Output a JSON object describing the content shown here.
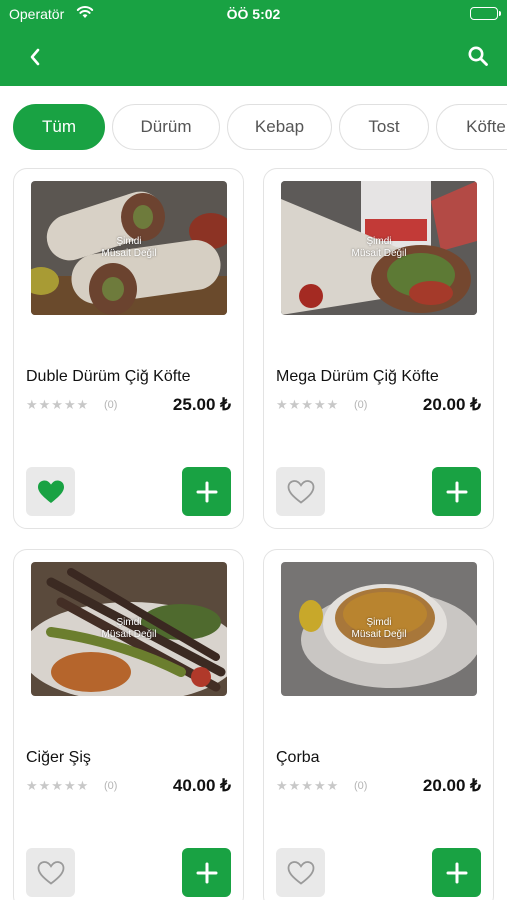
{
  "status_bar": {
    "carrier": "Operatör",
    "time": "ÖÖ 5:02"
  },
  "header": {
    "back_icon": "chevron-left-icon",
    "search_icon": "search-icon"
  },
  "categories": [
    {
      "label": "Tüm",
      "active": true
    },
    {
      "label": "Dürüm",
      "active": false
    },
    {
      "label": "Kebap",
      "active": false
    },
    {
      "label": "Tost",
      "active": false
    },
    {
      "label": "Köfte",
      "active": false
    }
  ],
  "products": [
    {
      "name": "Duble Dürüm Çiğ Köfte",
      "price": "25.00 ₺",
      "rating_count": "(0)",
      "stars": "★★★★★",
      "favorited": true,
      "availability_line1": "Şimdi",
      "availability_line2": "Müsait Değil",
      "image": "wrap-icon"
    },
    {
      "name": "Mega Dürüm Çiğ Köfte",
      "price": "20.00 ₺",
      "rating_count": "(0)",
      "stars": "★★★★★",
      "favorited": false,
      "availability_line1": "Şimdi",
      "availability_line2": "Müsait Değil",
      "image": "wrap-icon"
    },
    {
      "name": "Ciğer Şiş",
      "price": "40.00 ₺",
      "rating_count": "(0)",
      "stars": "★★★★★",
      "favorited": false,
      "availability_line1": "Şimdi",
      "availability_line2": "Müsait Değil",
      "image": "skewer-icon"
    },
    {
      "name": "Çorba",
      "price": "20.00 ₺",
      "rating_count": "(0)",
      "stars": "★★★★★",
      "favorited": false,
      "availability_line1": "Şimdi",
      "availability_line2": "Müsait Değil",
      "image": "soup-bowl-icon"
    }
  ],
  "colors": {
    "brand": "#19a243",
    "chip_border": "#e0e0e0",
    "fav_bg": "#e9e9e9",
    "heart_active": "#19a243",
    "heart_inactive": "#9a9a9a"
  }
}
